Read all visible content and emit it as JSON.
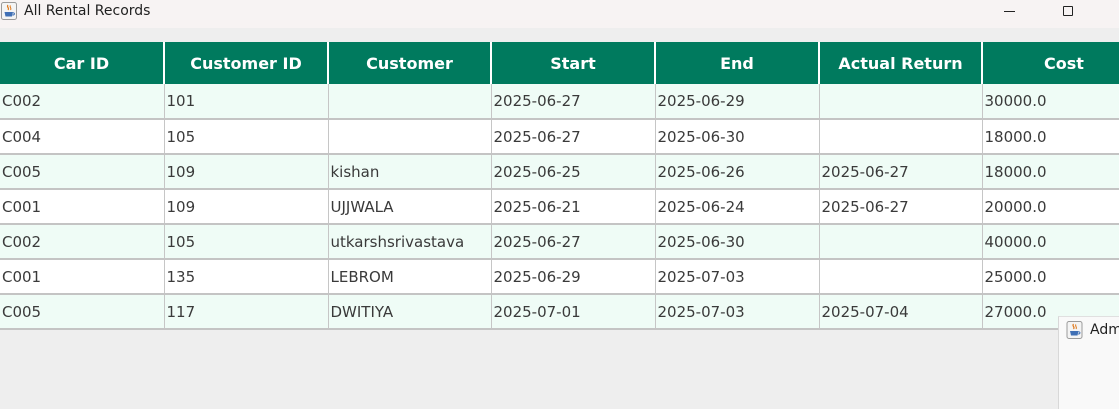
{
  "window": {
    "title": "All Rental Records",
    "icon": "java-cup-icon",
    "controls": [
      "minimize-icon",
      "maximize-icon"
    ]
  },
  "table": {
    "columns": [
      "Car ID",
      "Customer ID",
      "Customer",
      "Start",
      "End",
      "Actual Return",
      "Cost"
    ],
    "rows": [
      [
        "C002",
        "101",
        "",
        "2025-06-27",
        "2025-06-29",
        "",
        "30000.0"
      ],
      [
        "C004",
        "105",
        "",
        "2025-06-27",
        "2025-06-30",
        "",
        "18000.0"
      ],
      [
        "C005",
        "109",
        "kishan",
        "2025-06-25",
        "2025-06-26",
        "2025-06-27",
        "18000.0"
      ],
      [
        "C001",
        "109",
        "UJJWALA",
        "2025-06-21",
        "2025-06-24",
        "2025-06-27",
        "20000.0"
      ],
      [
        "C002",
        "105",
        "utkarshsrivastava",
        "2025-06-27",
        "2025-06-30",
        "",
        "40000.0"
      ],
      [
        "C001",
        "135",
        "LEBROM",
        "2025-06-29",
        "2025-07-03",
        "",
        "25000.0"
      ],
      [
        "C005",
        "117",
        "DWITIYA",
        "2025-07-01",
        "2025-07-03",
        "2025-07-04",
        "27000.0"
      ]
    ]
  },
  "background_window": {
    "title": "Adm",
    "icon": "java-cup-icon"
  },
  "colors": {
    "header_bg": "#007a5e",
    "header_text": "#ffffff",
    "row_alt_bg": "#effcf6",
    "row_bg": "#ffffff",
    "window_bg": "#eeeeee"
  }
}
